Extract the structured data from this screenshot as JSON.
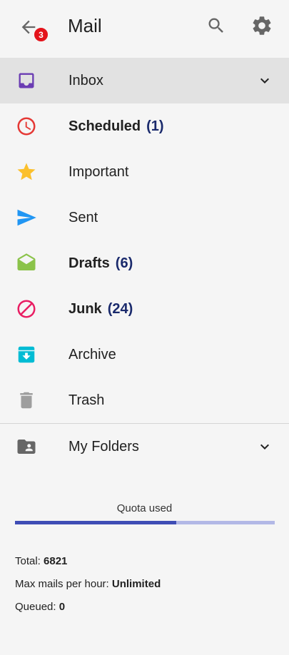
{
  "header": {
    "title": "Mail",
    "back_badge": "3"
  },
  "folders": [
    {
      "label": "Inbox",
      "count": "",
      "bold": false,
      "selected": true,
      "icon": "inbox-icon",
      "color": "#6b3db3"
    },
    {
      "label": "Scheduled",
      "count": "(1)",
      "bold": true,
      "selected": false,
      "icon": "clock-icon",
      "color": "#e53935"
    },
    {
      "label": "Important",
      "count": "",
      "bold": false,
      "selected": false,
      "icon": "star-icon",
      "color": "#fbc02d"
    },
    {
      "label": "Sent",
      "count": "",
      "bold": false,
      "selected": false,
      "icon": "send-icon",
      "color": "#2196f3"
    },
    {
      "label": "Drafts",
      "count": "(6)",
      "bold": true,
      "selected": false,
      "icon": "open-envelope-icon",
      "color": "#8bc34a"
    },
    {
      "label": "Junk",
      "count": "(24)",
      "bold": true,
      "selected": false,
      "icon": "block-icon",
      "color": "#e91e63"
    },
    {
      "label": "Archive",
      "count": "",
      "bold": false,
      "selected": false,
      "icon": "archive-icon",
      "color": "#00bcd4"
    },
    {
      "label": "Trash",
      "count": "",
      "bold": false,
      "selected": false,
      "icon": "trash-icon",
      "color": "#9e9e9e"
    }
  ],
  "my_folders": {
    "label": "My Folders",
    "icon": "shared-folder-icon"
  },
  "quota": {
    "label": "Quota used",
    "used_fraction": 0.62
  },
  "stats": {
    "total_label": "Total:",
    "total_value": "6821",
    "max_label": "Max mails per hour:",
    "max_value": "Unlimited",
    "queued_label": "Queued:",
    "queued_value": "0"
  }
}
